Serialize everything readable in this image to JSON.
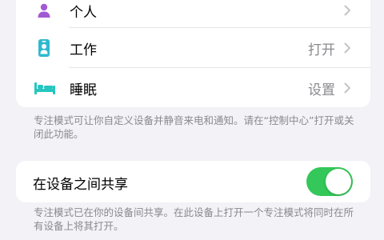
{
  "focus_modes": [
    {
      "label": "个人",
      "value": "",
      "icon": "person-icon",
      "color": "#a25ad4"
    },
    {
      "label": "工作",
      "value": "打开",
      "icon": "id-badge-icon",
      "color": "#2fb8d0"
    },
    {
      "label": "睡眠",
      "value": "设置",
      "icon": "bed-icon",
      "color": "#26c6c0"
    }
  ],
  "focus_footnote": "专注模式可让你自定义设备并静音来电和通知。请在“控制中心”打开或关闭此功能。",
  "share": {
    "label": "在设备之间共享",
    "enabled": true,
    "toggle_color": "#34c759",
    "footnote": "专注模式已在你的设备间共享。在此设备上打开一个专注模式将同时在所有设备上将其打开。"
  }
}
